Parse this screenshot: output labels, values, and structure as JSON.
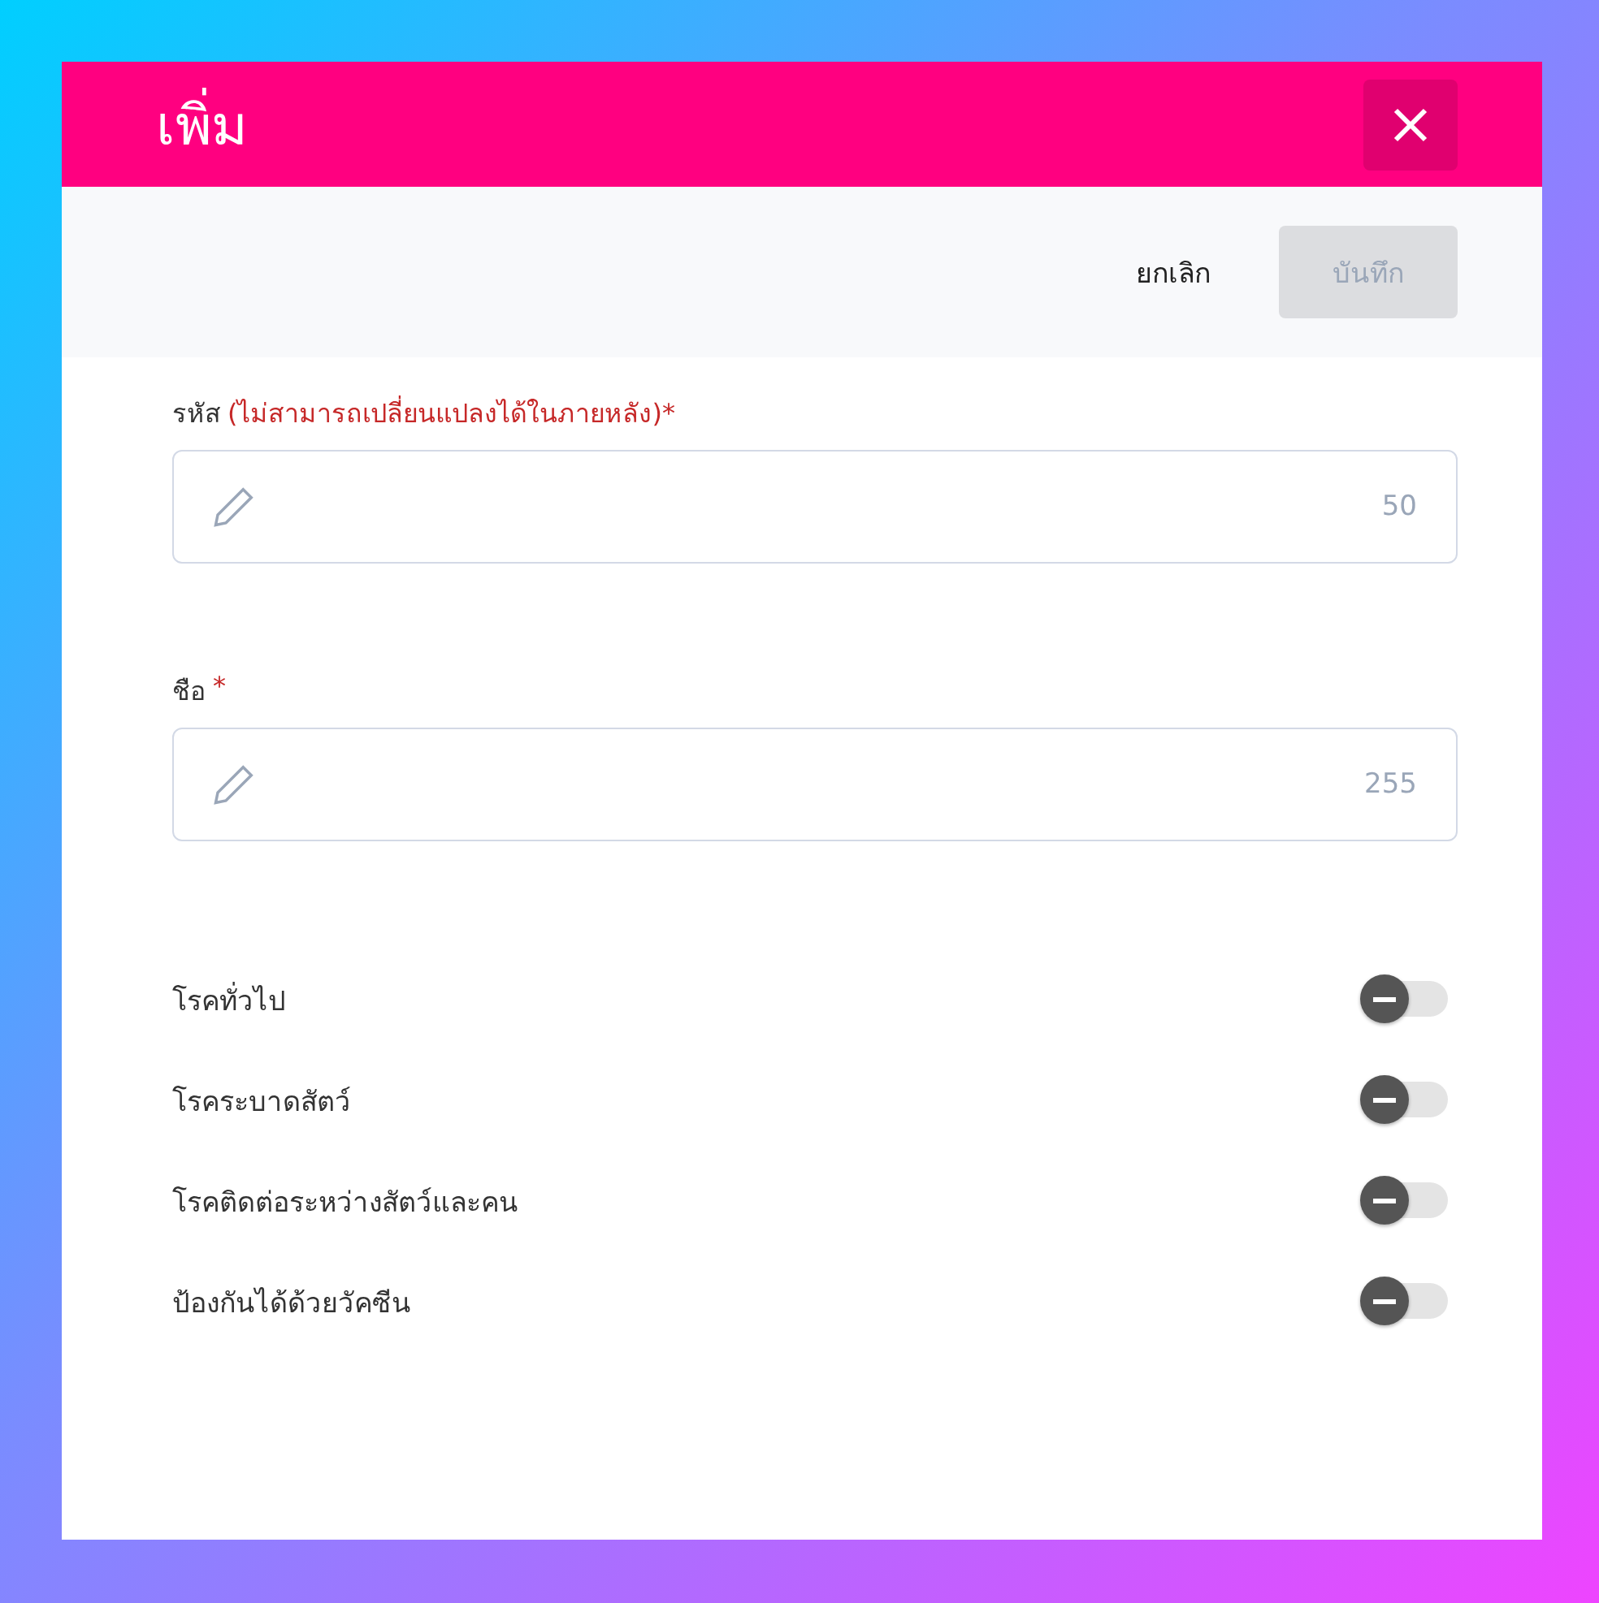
{
  "dialog": {
    "title": "เพิ่ม"
  },
  "toolbar": {
    "cancel": "ยกเลิก",
    "save": {
      "label": "บันทึก",
      "disabled": true
    }
  },
  "fields": [
    {
      "label": "รหัส",
      "hint": "(ไม่สามารถเปลี่ยนแปลงได้ในภายหลัง)*",
      "counter": "50"
    },
    {
      "label": "ชือ",
      "hint": "*",
      "counter": "255"
    }
  ],
  "toggles": [
    {
      "label": "โรคทั่วไป",
      "on": false
    },
    {
      "label": "โรคระบาดสัตว์",
      "on": false
    },
    {
      "label": "โรคติดต่อระหว่างสัตว์และคน",
      "on": false
    },
    {
      "label": "ป้องกันได้ด้วยวัคซีน",
      "on": false
    }
  ]
}
